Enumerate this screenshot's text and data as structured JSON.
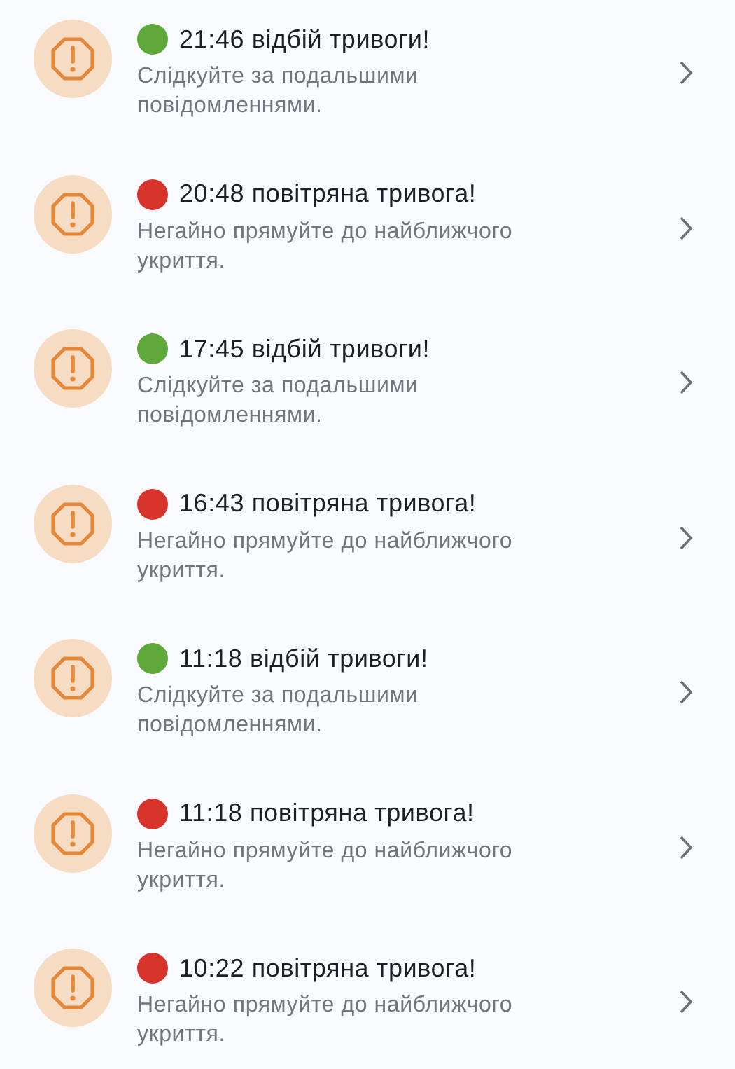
{
  "alerts": [
    {
      "title": "21:46 відбій тривоги!",
      "color": "#5fa93a",
      "message": "Слідкуйте за подальшими повідомленнями."
    },
    {
      "title": "20:48 повітряна тривога!",
      "color": "#d7342c",
      "message": "Негайно прямуйте до найближчого укриття."
    },
    {
      "title": "17:45 відбій тривоги!",
      "color": "#5fa93a",
      "message": "Слідкуйте за подальшими повідомленнями."
    },
    {
      "title": "16:43 повітряна тривога!",
      "color": "#d7342c",
      "message": "Негайно прямуйте до найближчого укриття."
    },
    {
      "title": "11:18 відбій тривоги!",
      "color": "#5fa93a",
      "message": "Слідкуйте за подальшими повідомленнями."
    },
    {
      "title": "11:18 повітряна тривога!",
      "color": "#d7342c",
      "message": "Негайно прямуйте до найближчого укриття."
    },
    {
      "title": "10:22 повітряна тривога!",
      "color": "#d7342c",
      "message": "Негайно прямуйте до найближчого укриття."
    }
  ]
}
